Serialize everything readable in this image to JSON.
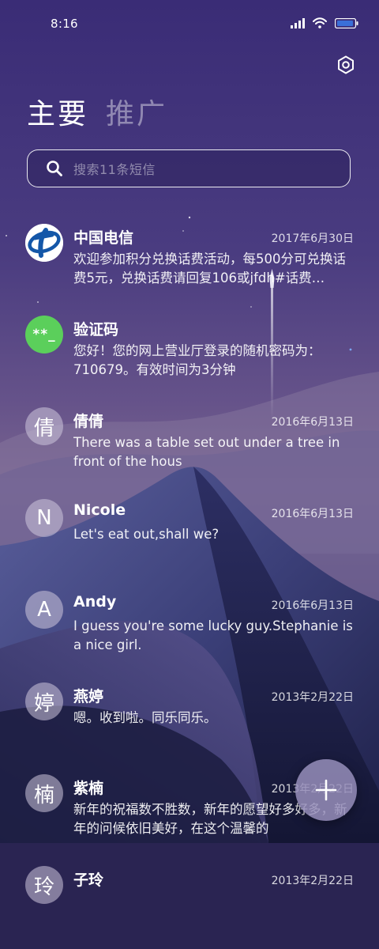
{
  "status_bar": {
    "time": "8:16",
    "icons": [
      "signal-icon",
      "wifi-icon",
      "battery-icon"
    ]
  },
  "header": {
    "settings_icon": "settings-icon",
    "tabs": [
      {
        "label": "主要",
        "active": true
      },
      {
        "label": "推广",
        "active": false
      }
    ]
  },
  "search": {
    "placeholder": "搜索11条短信",
    "icon": "search-icon"
  },
  "messages": [
    {
      "sender": "中国电信",
      "date": "2017年6月30日",
      "preview": "欢迎参加积分兑换话费活动，每500分可兑换话费5元，兑换话费请回复106或jfdh#话费…",
      "avatar": "",
      "avatar_type": "china-telecom-logo"
    },
    {
      "sender": "验证码",
      "date": "",
      "preview": "您好！您的网上营业厅登录的随机密码为：710679。有效时间为3分钟",
      "avatar": "**_",
      "avatar_type": "verification-code"
    },
    {
      "sender": "倩倩",
      "date": "2016年6月13日",
      "preview": "There was a table set out under a tree in front of the hous",
      "avatar": "倩",
      "avatar_type": "letter"
    },
    {
      "sender": "Nicole",
      "date": "2016年6月13日",
      "preview": "Let's eat out,shall we?",
      "avatar": "N",
      "avatar_type": "letter"
    },
    {
      "sender": "Andy",
      "date": "2016年6月13日",
      "preview": "I guess you're some lucky guy.Stephanie is a nice girl.",
      "avatar": "A",
      "avatar_type": "letter"
    },
    {
      "sender": "燕婷",
      "date": "2013年2月22日",
      "preview": "嗯。收到啦。同乐同乐。",
      "avatar": "婷",
      "avatar_type": "letter"
    },
    {
      "sender": "紫楠",
      "date": "2013年2月22日",
      "preview": "新年的祝福数不胜数，新年的愿望好多好多，新年的问候依旧美好，在这个温馨的",
      "avatar": "楠",
      "avatar_type": "letter"
    },
    {
      "sender": "子玲",
      "date": "2013年2月22日",
      "preview": "",
      "avatar": "玲",
      "avatar_type": "letter"
    }
  ],
  "fab": {
    "icon": "plus-icon"
  },
  "colors": {
    "bg_top": "#3d2f78",
    "bg_mid": "#5b4a85",
    "mountain_dark": "#1c1e3e",
    "accent_green": "#5bcf5b",
    "telecom_blue": "#1457a8"
  }
}
